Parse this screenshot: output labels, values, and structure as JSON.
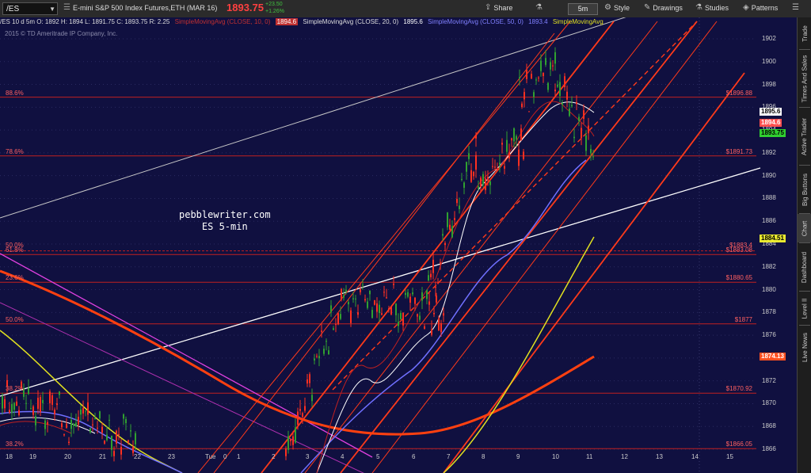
{
  "toolbar": {
    "symbol": "/ES",
    "description": "E-mini S&P 500 Index Futures,ETH (MAR 16)",
    "last_price": "1893.75",
    "change_1": "+23.50",
    "change_2": "+1.26%",
    "share_label": "Share",
    "timeframe": "5m",
    "style_label": "Style",
    "drawings_label": "Drawings",
    "studies_label": "Studies",
    "patterns_label": "Patterns"
  },
  "study_line": {
    "header": "/ES 10 d 5m  O: 1892  H: 1894  L: 1891.75  C: 1893.75  R: 2.25",
    "sma10_label": "SimpleMovingAvg (CLOSE, 10, 0)",
    "sma10_value": "1894.6",
    "sma20_label": "SimpleMovingAvg (CLOSE, 20, 0)",
    "sma20_value": "1895.6",
    "sma50_label": "SimpleMovingAvg (CLOSE, 50, 0)",
    "sma50_value": "1893.4",
    "sma200_label": "SimpleMovingAvg"
  },
  "copyright": "2015 © TD Ameritrade IP Company, Inc.",
  "watermark": {
    "line1": "pebblewriter.com",
    "line2": "ES 5-min"
  },
  "sidebar": [
    "Trade",
    "Times And Sales",
    "Active Trader",
    "Big Buttons",
    "Chart",
    "Dashboard",
    "Level II",
    "Live News"
  ],
  "y_axis": [
    "1902",
    "1900",
    "1898",
    "1896",
    "1894",
    "1892",
    "1890",
    "1888",
    "1886",
    "1884",
    "1882",
    "1880",
    "1878",
    "1876",
    "1874",
    "1872",
    "1870",
    "1868",
    "1866"
  ],
  "x_axis": [
    "18",
    "19",
    "20",
    "21",
    "22",
    "23",
    "Tue",
    "0",
    "1",
    "2",
    "3",
    "4",
    "5",
    "6",
    "7",
    "8",
    "9",
    "10",
    "11",
    "12",
    "13",
    "14",
    "15"
  ],
  "fib_levels": [
    {
      "pct": "88.6%",
      "price": "$1896.88"
    },
    {
      "pct": "78.6%",
      "price": "$1891.73"
    },
    {
      "pct": "61.8%",
      "price": "$1883.08"
    },
    {
      "pct": "23.6%",
      "price": "$1880.65"
    },
    {
      "pct": "50.0%",
      "price": "$1877"
    },
    {
      "pct": "38.2%",
      "price": "$1870.92"
    },
    {
      "pct": "38.2%",
      "price": "$1866.05"
    }
  ],
  "fib_extra": {
    "pct": "50.0%",
    "price": "$1883.4"
  },
  "price_tags": [
    {
      "value": "1895.6",
      "color": "#ffffff",
      "y_price": 1895.6
    },
    {
      "value": "1894.6",
      "color": "#ff5050",
      "y_price": 1894.6
    },
    {
      "value": "1893.75",
      "color": "#30d030",
      "y_price": 1893.75
    },
    {
      "value": "1884.51",
      "color": "#e8e830",
      "y_price": 1884.51
    },
    {
      "value": "1874.13",
      "color": "#ff5020",
      "y_price": 1874.13
    }
  ],
  "colors": {
    "bg": "#101040",
    "fib": "#c02020",
    "channel": "#ff3a1a",
    "sma10": "#c02020",
    "sma20": "#ffffff",
    "sma50": "#7070ff",
    "sma200_yellow": "#e0e020",
    "sma_orange": "#ff4010",
    "up": "#30a030",
    "down": "#ff3020"
  }
}
